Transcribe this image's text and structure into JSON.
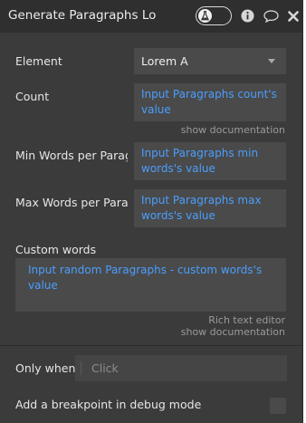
{
  "header": {
    "title": "Generate Paragraphs Lo",
    "toggle_on": true
  },
  "fields": {
    "element": {
      "label": "Element",
      "value": "Lorem A"
    },
    "count": {
      "label": "Count",
      "value": "Input Paragraphs count's value",
      "doc_link": "show documentation"
    },
    "min_words": {
      "label": "Min Words per Paragr",
      "value": "Input Paragraphs min words's value"
    },
    "max_words": {
      "label": "Max Words per Parag",
      "value": "Input Paragraphs max words's value"
    },
    "custom_words": {
      "label": "Custom words",
      "value": "Input random Paragraphs - custom words's value",
      "rich_text_link": "Rich text editor",
      "doc_link": "show documentation"
    }
  },
  "only_when": {
    "label": "Only when",
    "placeholder": "Click"
  },
  "breakpoint": {
    "label": "Add a breakpoint in debug mode",
    "checked": false
  },
  "colors": {
    "panel_bg": "#3b3b3b",
    "header_bg": "#2f2f2f",
    "field_bg": "#4a4a4a",
    "dynamic_text": "#4a9eff"
  }
}
